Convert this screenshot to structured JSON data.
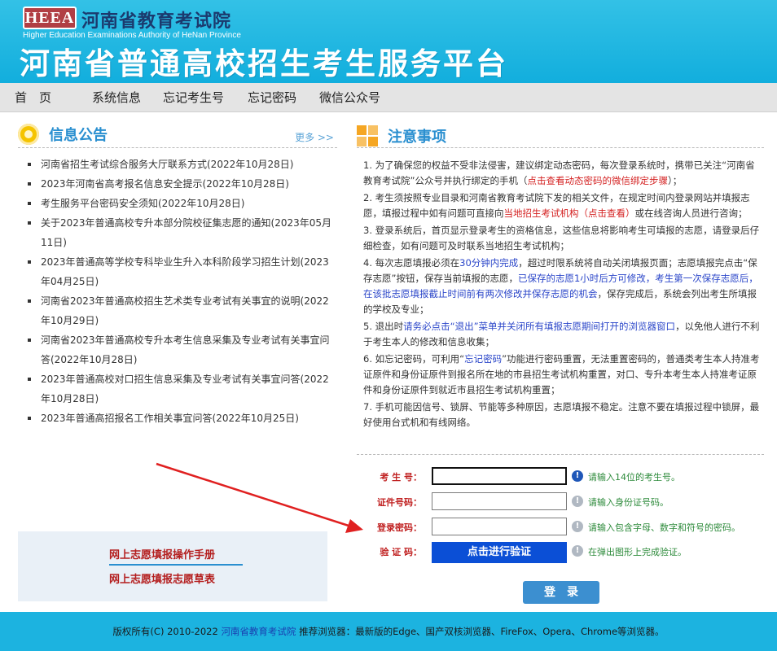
{
  "header": {
    "logo_text": "HEEA",
    "org_name": "河南省教育考试院",
    "org_name_en": "Higher Education Examinations Authority of HeNan Province",
    "platform_title": "河南省普通高校招生考生服务平台"
  },
  "nav": {
    "items": [
      "首　页",
      "系统信息",
      "忘记考生号",
      "忘记密码",
      "微信公众号"
    ]
  },
  "announcements": {
    "title": "信息公告",
    "more": "更多 >>",
    "items": [
      "河南省招生考试综合服务大厅联系方式(2022年10月28日)",
      "2023年河南省高考报名信息安全提示(2022年10月28日)",
      "考生服务平台密码安全须知(2022年10月28日)",
      "关于2023年普通高校专升本部分院校征集志愿的通知(2023年05月11日)",
      "2023年普通高等学校专科毕业生升入本科阶段学习招生计划(2023年04月25日)",
      "河南省2023年普通高校招生艺术类专业考试有关事宜的说明(2022年10月29日)",
      "河南省2023年普通高校专升本考生信息采集及专业考试有关事宜问答(2022年10月28日)",
      "2023年普通高校对口招生信息采集及专业考试有关事宜问答(2022年10月28日)",
      "2023年普通高招报名工作相关事宜问答(2022年10月25日)"
    ]
  },
  "manuals": {
    "link1": "网上志愿填报操作手册",
    "link2": "网上志愿填报志愿草表"
  },
  "notice": {
    "title": "注意事项",
    "items": [
      [
        {
          "t": "1. 为了确保您的权益不受非法侵害，建议绑定动态密码，每次登录系统时，携带已关注“河南省教育考试院”公众号并执行绑定的手机（"
        },
        {
          "t": "点击查看动态密码的微信绑定步骤",
          "c": "red"
        },
        {
          "t": "）；"
        }
      ],
      [
        {
          "t": "2. 考生须按照专业目录和河南省教育考试院下发的相关文件，在规定时间内登录网站并填报志愿，填报过程中如有问题可直接向"
        },
        {
          "t": "当地招生考试机构（点击查看）",
          "c": "red"
        },
        {
          "t": "或在线咨询人员进行咨询；"
        }
      ],
      [
        {
          "t": "3. 登录系统后，首页显示登录考生的资格信息，这些信息将影响考生可填报的志愿，请登录后仔细检查，如有问题可及时联系当地招生考试机构；"
        }
      ],
      [
        {
          "t": "4. 每次志愿填报必须在"
        },
        {
          "t": "30分钟内完成",
          "c": "blue"
        },
        {
          "t": "，超过时限系统将自动关闭填报页面；志愿填报完点击“保存志愿”按钮，保存当前填报的志愿，"
        },
        {
          "t": "已保存的志愿1小时后方可修改，考生第一次保存志愿后，在该批志愿填报截止时间前有两次修改并保存志愿的机会",
          "c": "blue"
        },
        {
          "t": "，保存完成后，系统会列出考生所填报的学校及专业；"
        }
      ],
      [
        {
          "t": "5. 退出时"
        },
        {
          "t": "请务必点击“退出”菜单并关闭所有填报志愿期间打开的浏览器窗口",
          "c": "blue"
        },
        {
          "t": "，以免他人进行不利于考生本人的修改和信息收集；"
        }
      ],
      [
        {
          "t": "6. 如忘记密码，可利用“"
        },
        {
          "t": "忘记密码",
          "c": "blue"
        },
        {
          "t": "”功能进行密码重置，无法重置密码的，普通类考生本人持准考证原件和身份证原件到报名所在地的市县招生考试机构重置，对口、专升本考生本人持准考证原件和身份证原件到就近市县招生考试机构重置；"
        }
      ],
      [
        {
          "t": "7. 手机可能因信号、锁屏、节能等多种原因，志愿填报不稳定。注意不要在填报过程中锁屏，最好使用台式机和有线网络。"
        }
      ]
    ]
  },
  "form": {
    "exam_no_label": "考 生 号：",
    "exam_no_value": "",
    "exam_no_hint": "请输入14位的考生号。",
    "id_label": "证件号码：",
    "id_value": "",
    "id_hint": "请输入身份证号码。",
    "password_label": "登录密码：",
    "password_value": "",
    "password_hint": "请输入包含字母、数字和符号的密码。",
    "captcha_label": "验 证 码：",
    "captcha_button": "点击进行验证",
    "captcha_hint": "在弹出图形上完成验证。",
    "login_button": "登录"
  },
  "footer": {
    "copyright": "版权所有(C) 2010-2022",
    "org_link": "河南省教育考试院",
    "browsers": "推荐浏览器：最新版的Edge、国产双核浏览器、FireFox、Opera、Chrome等浏览器。"
  },
  "colors": {
    "header_bg": "#1cb3e0",
    "accent_blue": "#2a8fd0",
    "alert_red": "#d42222",
    "button_blue": "#0b4fd6",
    "arrow_red": "#e02020"
  }
}
